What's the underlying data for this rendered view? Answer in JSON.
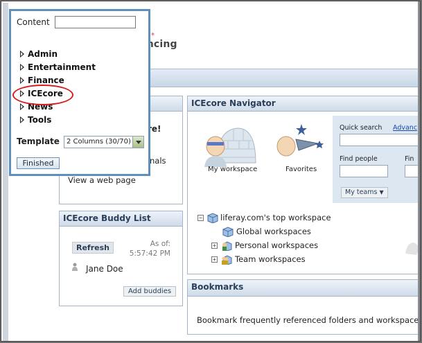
{
  "page": {
    "title": "encing"
  },
  "popup": {
    "content_label": "Content",
    "content_value": "",
    "categories": [
      "Admin",
      "Entertainment",
      "Finance",
      "ICEcore",
      "News",
      "Tools"
    ],
    "template_label": "Template",
    "template_value": "2 Columns (30/70)",
    "finished_label": "Finished"
  },
  "welcome": {
    "items": [
      "re!",
      "nals",
      "View a web page"
    ]
  },
  "buddy": {
    "title": "ICEcore Buddy List",
    "refresh_label": "Refresh",
    "as_of": "As of: 5:57:42 PM",
    "buddy_name": "Jane Doe",
    "add_buddies_label": "Add buddies"
  },
  "navigator": {
    "title": "ICEcore Navigator",
    "my_workspace": "My workspace",
    "favorites": "Favorites",
    "quick_search_label": "Quick search",
    "advanced_link": "Advanc",
    "find_people_label": "Find people",
    "find_other_label": "Fin",
    "my_teams_label": "My teams",
    "tree": {
      "root": "liferay.com's top workspace",
      "children": [
        "Global workspaces",
        "Personal workspaces",
        "Team workspaces"
      ]
    }
  },
  "bookmarks": {
    "title": "Bookmarks",
    "text": "Bookmark frequently referenced folders and workspace"
  },
  "colors": {
    "accent": "#5f8fbf",
    "highlight": "#d61d1d",
    "link": "#1a47b0"
  }
}
